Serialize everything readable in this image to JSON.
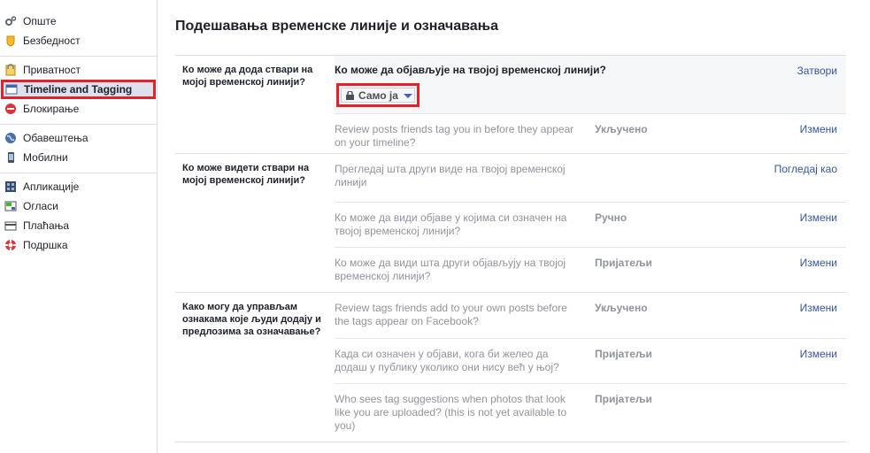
{
  "sidebar": {
    "groups": [
      [
        {
          "id": "general",
          "label": "Опште",
          "icon": "gear-icon"
        },
        {
          "id": "security",
          "label": "Безбедност",
          "icon": "shield-icon"
        }
      ],
      [
        {
          "id": "privacy",
          "label": "Приватност",
          "icon": "lock-icon"
        },
        {
          "id": "timeline",
          "label": "Timeline and Tagging",
          "icon": "timeline-icon",
          "selected": true
        },
        {
          "id": "blocking",
          "label": "Блокирање",
          "icon": "block-icon"
        }
      ],
      [
        {
          "id": "notifications",
          "label": "Обавештења",
          "icon": "globe-icon"
        },
        {
          "id": "mobile",
          "label": "Мобилни",
          "icon": "mobile-icon"
        }
      ],
      [
        {
          "id": "apps",
          "label": "Апликације",
          "icon": "apps-icon"
        },
        {
          "id": "ads",
          "label": "Огласи",
          "icon": "ads-icon"
        },
        {
          "id": "payments",
          "label": "Плаћања",
          "icon": "card-icon"
        },
        {
          "id": "support",
          "label": "Подршка",
          "icon": "lifebuoy-icon"
        }
      ]
    ]
  },
  "page": {
    "title": "Подешавања временске линије и означавања"
  },
  "sections": [
    {
      "label": "Ко може да дода ствари на мојој временској линији?",
      "rows": [
        {
          "text": "Ко може да објављује на твојој временској линији?",
          "status": "",
          "action": "Затвори",
          "expanded": true,
          "privacy_label": "Само ја"
        },
        {
          "text": "Review posts friends tag you in before they appear on your timeline?",
          "status": "Укључено",
          "action": "Измени"
        }
      ]
    },
    {
      "label": "Ко може видети ствари на мојој временској линији?",
      "rows": [
        {
          "text": "Прегледај шта други виде на твојој временској линији",
          "status": "",
          "action": "Погледај као"
        },
        {
          "text": "Ко може да види објаве у којима си означен на твојој временској линији?",
          "status": "Ручно",
          "action": "Измени"
        },
        {
          "text": "Ко може да види шта други објављују на твојој временској линији?",
          "status": "Пријатељи",
          "action": "Измени"
        }
      ]
    },
    {
      "label": "Како могу да управљам ознакама које људи додају и предлозима за означавање?",
      "rows": [
        {
          "text": "Review tags friends add to your own posts before the tags appear on Facebook?",
          "status": "Укључено",
          "action": "Измени"
        },
        {
          "text": "Када си означен у објави, кога би желео да додаш у публику уколико они нису већ у њој?",
          "status": "Пријатељи",
          "action": "Измени"
        },
        {
          "text": "Who sees tag suggestions when photos that look like you are uploaded? (this is not yet available to you)",
          "status": "Пријатељи",
          "action": ""
        }
      ]
    }
  ]
}
